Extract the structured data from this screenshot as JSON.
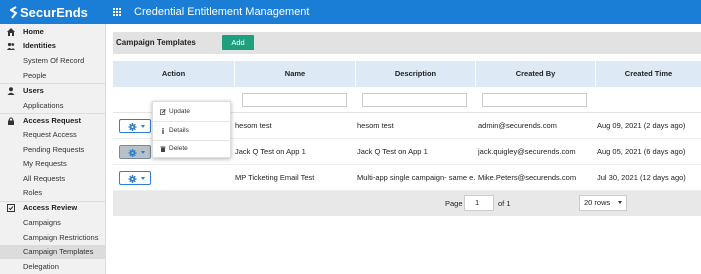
{
  "header": {
    "logo_text": "SecurEnds",
    "app_title": "Credential Entitlement Management"
  },
  "sidebar": {
    "items": [
      {
        "label": "Home",
        "type": "head",
        "icon": "home-icon"
      },
      {
        "label": "Identities",
        "type": "head",
        "icon": "identities-icon"
      },
      {
        "label": "System Of Record",
        "type": "sub"
      },
      {
        "label": "People",
        "type": "sub"
      },
      {
        "label": "Users",
        "type": "head",
        "icon": "user-icon"
      },
      {
        "label": "Applications",
        "type": "sub"
      },
      {
        "label": "Access Request",
        "type": "head",
        "icon": "lock-icon"
      },
      {
        "label": "Request Access",
        "type": "sub"
      },
      {
        "label": "Pending Requests",
        "type": "sub"
      },
      {
        "label": "My Requests",
        "type": "sub"
      },
      {
        "label": "All Requests",
        "type": "sub"
      },
      {
        "label": "Roles",
        "type": "sub"
      },
      {
        "label": "Access Review",
        "type": "head",
        "icon": "review-icon"
      },
      {
        "label": "Campaigns",
        "type": "sub"
      },
      {
        "label": "Campaign Restrictions",
        "type": "sub"
      },
      {
        "label": "Campaign Templates",
        "type": "sub",
        "active": true
      },
      {
        "label": "Delegation",
        "type": "sub"
      }
    ]
  },
  "page": {
    "title": "Campaign Templates",
    "add_label": "Add"
  },
  "table": {
    "columns": [
      "Action",
      "Name",
      "Description",
      "Created By",
      "Created Time"
    ],
    "rows": [
      {
        "name": "hesom test",
        "description": "hesom test",
        "created_by": "admin@securends.com",
        "created_time": "Aug 09, 2021 (2 days ago)"
      },
      {
        "name": "Jack Q Test on App 1",
        "description": "Jack Q Test on App 1",
        "created_by": "jack.quigley@securends.com",
        "created_time": "Aug 05, 2021 (6 days ago)"
      },
      {
        "name": "MP Ticketing Email Test",
        "description": "Multi-app single campaign- same e…",
        "created_by": "Mike.Peters@securends.com",
        "created_time": "Jul 30, 2021 (12 days ago)"
      }
    ]
  },
  "action_menu": {
    "items": [
      {
        "label": "Update",
        "icon": "edit-icon"
      },
      {
        "label": "Details",
        "icon": "info-icon"
      },
      {
        "label": "Delete",
        "icon": "trash-icon"
      }
    ]
  },
  "pagination": {
    "page_label": "Page",
    "page_value": "1",
    "of_label": "of 1",
    "rows_option": "20 rows"
  },
  "colors": {
    "brand": "#1a7ed6",
    "add_button": "#1ea07f",
    "table_header": "#ddeaf6"
  }
}
